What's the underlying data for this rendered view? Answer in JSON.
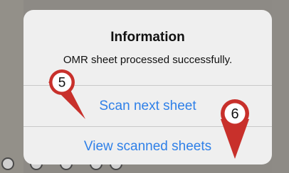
{
  "dialog": {
    "title": "Information",
    "message": "OMR sheet processed successfully.",
    "actions": [
      {
        "label": "Scan next sheet"
      },
      {
        "label": "View scanned sheets"
      }
    ]
  },
  "markers": [
    {
      "number": "5"
    },
    {
      "number": "6"
    }
  ],
  "colors": {
    "accent": "#2f80e8",
    "marker": "#c8302b",
    "dialog_bg": "#efefef",
    "overlay": "#8d8a85"
  }
}
